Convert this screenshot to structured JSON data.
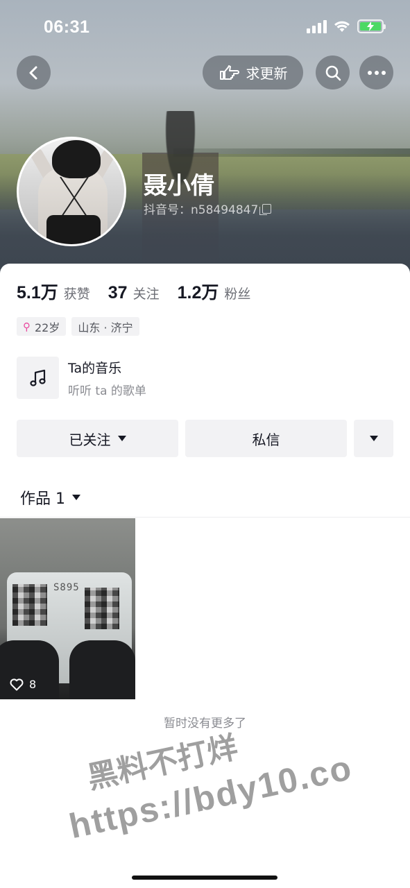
{
  "status_bar": {
    "time": "06:31"
  },
  "header": {
    "request_update_label": "求更新",
    "nickname": "聂小倩",
    "douyin_id": "抖音号：n58494847"
  },
  "stats": [
    {
      "value": "5.1万",
      "label": "获赞"
    },
    {
      "value": "37",
      "label": "关注"
    },
    {
      "value": "1.2万",
      "label": "粉丝"
    }
  ],
  "tags": {
    "age": "22岁",
    "location": "山东 · 济宁"
  },
  "music": {
    "title": "Ta的音乐",
    "subtitle": "听听 ta 的歌单"
  },
  "actions": {
    "follow_label": "已关注",
    "message_label": "私信"
  },
  "works": {
    "tab_label": "作品 1",
    "items": [
      {
        "scale_display": "S895",
        "likes": "8"
      }
    ],
    "no_more": "暂时没有更多了"
  },
  "watermark": {
    "line1": "黑料不打烊",
    "line2": "https://bdy10.co"
  },
  "colors": {
    "female": "#e94a9f",
    "battery": "#4cd964"
  }
}
